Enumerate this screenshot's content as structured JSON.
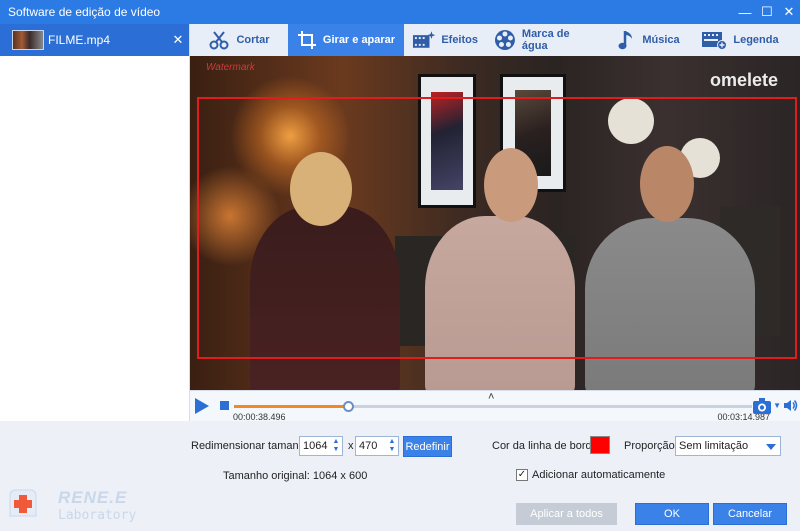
{
  "window": {
    "title": "Software de edição de vídeo",
    "controls": {
      "minimize": "—",
      "maximize": "☐",
      "close": "✕"
    }
  },
  "sidebar": {
    "files": [
      {
        "name": "FILME.mp4",
        "close": "✕"
      }
    ]
  },
  "toolbar": {
    "tabs": [
      {
        "label": "Cortar",
        "icon": "scissors-icon",
        "active": false
      },
      {
        "label": "Girar e aparar",
        "icon": "crop-icon",
        "active": true
      },
      {
        "label": "Efeitos",
        "icon": "film-effects-icon",
        "active": false
      },
      {
        "label": "Marca de água",
        "icon": "film-reel-icon",
        "active": false
      },
      {
        "label": "Música",
        "icon": "music-note-icon",
        "active": false
      },
      {
        "label": "Legenda",
        "icon": "subtitle-icon",
        "active": false
      }
    ]
  },
  "preview": {
    "watermark_text": "Watermark",
    "brand_text": "omelete",
    "crop_border_color": "#e01c1c"
  },
  "player": {
    "current_time": "00:00:38.496",
    "total_time": "00:03:14.987",
    "progress": 0.22,
    "slider_position": 0.22,
    "expand_caret": "˄"
  },
  "settings": {
    "resize_label": "Redimensionar tamanho:",
    "width": "1064",
    "by": "x",
    "height": "470",
    "reset_button": "Redefinir",
    "original_size_label": "Tamanho original: 1064 x 600",
    "border_color_label": "Cor da linha de borda:",
    "border_color": "#ff0000",
    "ratio_label": "Proporção:",
    "ratio_value": "Sem limitação",
    "auto_add_label": "Adicionar automaticamente",
    "auto_add_checked": true
  },
  "branding": {
    "title": "RENE.E",
    "subtitle": "Laboratory"
  },
  "footer": {
    "apply_all": "Aplicar a todos",
    "ok": "OK",
    "cancel": "Cancelar"
  }
}
